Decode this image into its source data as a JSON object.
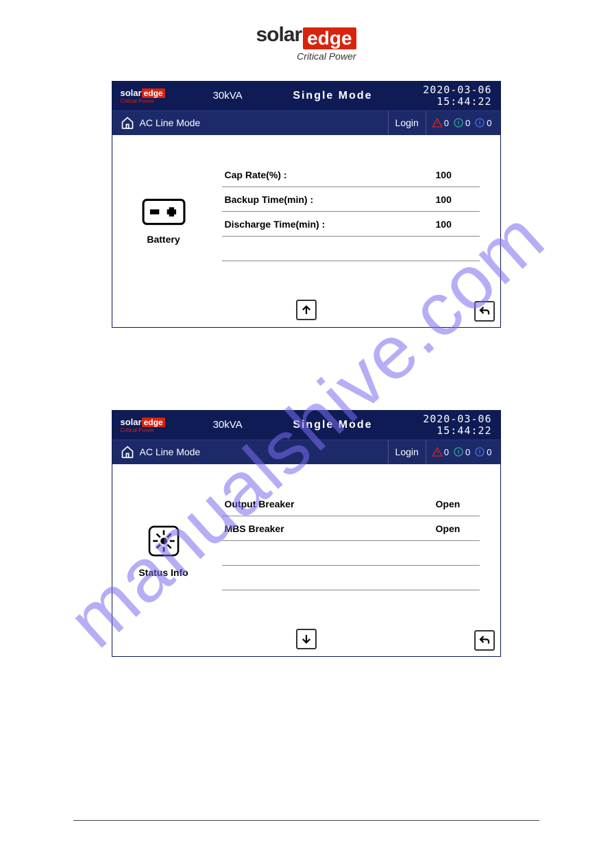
{
  "brand": {
    "solar": "solar",
    "edge": "edge",
    "tagline": "Critical Power"
  },
  "watermark": "manualshive.com",
  "panels": [
    {
      "kva": "30kVA",
      "mode_title": "Single  Mode",
      "date": "2020-03-06",
      "time": "15:44:22",
      "line_mode": "AC Line Mode",
      "login": "Login",
      "status": {
        "warn": "0",
        "info1": "0",
        "info2": "0"
      },
      "section_label": "Battery",
      "rows": [
        {
          "label": "Cap Rate(%) :",
          "value": "100"
        },
        {
          "label": "Backup Time(min) :",
          "value": "100"
        },
        {
          "label": "Discharge Time(min) :",
          "value": "100"
        },
        {
          "label": "",
          "value": ""
        }
      ],
      "nav_arrow_dir": "up",
      "caption": ""
    },
    {
      "kva": "30kVA",
      "mode_title": "Single  Mode",
      "date": "2020-03-06",
      "time": "15:44:22",
      "line_mode": "AC Line Mode",
      "login": "Login",
      "status": {
        "warn": "0",
        "info1": "0",
        "info2": "0"
      },
      "section_label": "Status Info",
      "rows": [
        {
          "label": "Output Breaker",
          "value": "Open"
        },
        {
          "label": "MBS Breaker",
          "value": "Open"
        },
        {
          "label": "",
          "value": ""
        },
        {
          "label": "",
          "value": ""
        }
      ],
      "nav_arrow_dir": "down",
      "caption": ""
    }
  ],
  "footer": {
    "left": "",
    "right": ""
  }
}
